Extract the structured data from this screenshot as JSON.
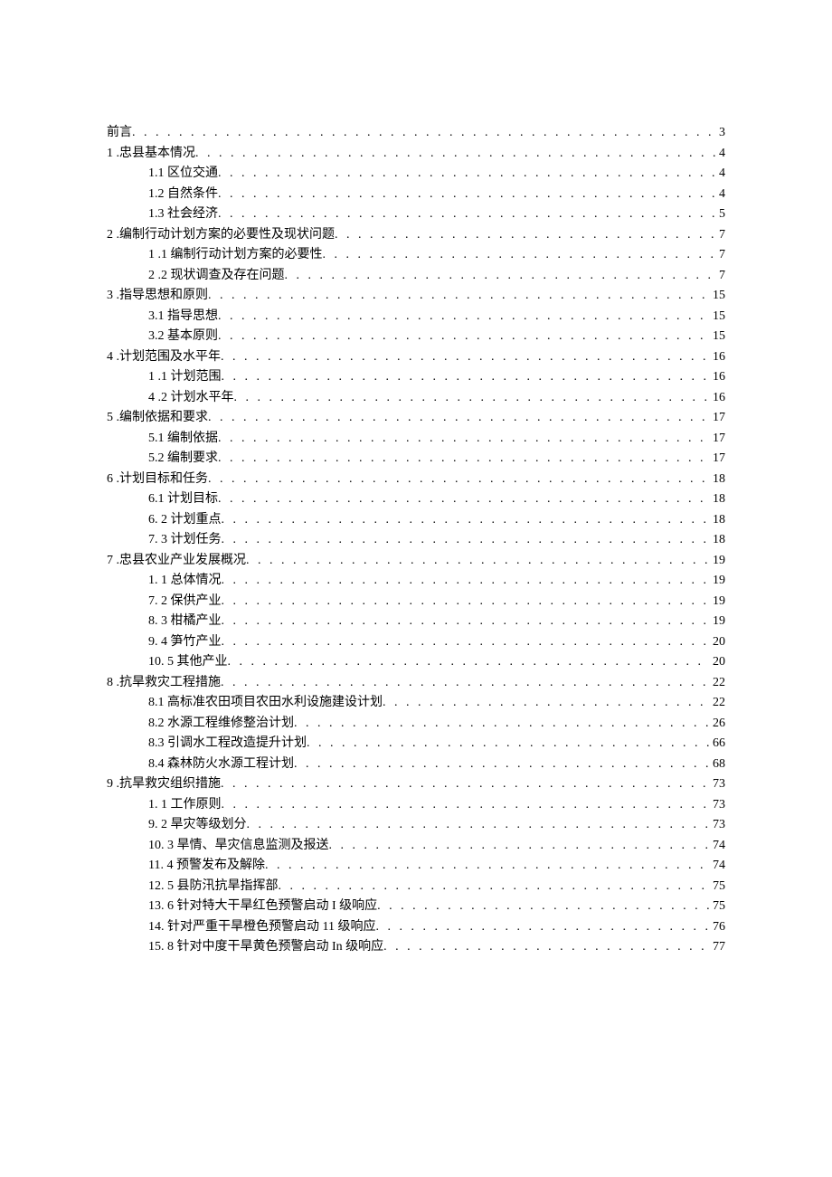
{
  "toc": [
    {
      "level": 0,
      "label": "前言",
      "page": "3"
    },
    {
      "level": 0,
      "label": "1 .忠县基本情况",
      "page": "4"
    },
    {
      "level": 1,
      "label": "1.1   区位交通",
      "page": "4"
    },
    {
      "level": 1,
      "label": "1.2   自然条件",
      "page": "4"
    },
    {
      "level": 1,
      "label": "1.3   社会经济",
      "page": "5"
    },
    {
      "level": 0,
      "label": "2   .编制行动计划方案的必要性及现状问题",
      "page": "7"
    },
    {
      "level": 1,
      "label": "1   .1 编制行动计划方案的必要性",
      "page": "7"
    },
    {
      "level": 1,
      "label": "2   .2 现状调查及存在问题",
      "page": "7"
    },
    {
      "level": 0,
      "label": "3   .指导思想和原则",
      "page": "15"
    },
    {
      "level": 1,
      "label": "3.1    指导思想",
      "page": "15"
    },
    {
      "level": 1,
      "label": "3.2    基本原则",
      "page": "15"
    },
    {
      "level": 0,
      "label": "4   .计划范围及水平年",
      "page": "16"
    },
    {
      "level": 1,
      "label": "1   .1 计划范围",
      "page": "16"
    },
    {
      "level": 1,
      "label": "4   .2 计划水平年",
      "page": "16"
    },
    {
      "level": 0,
      "label": "5   .编制依据和要求",
      "page": "17"
    },
    {
      "level": 1,
      "label": "5.1    编制依据",
      "page": "17"
    },
    {
      "level": 1,
      "label": "5.2    编制要求",
      "page": "17"
    },
    {
      "level": 0,
      "label": "6   .计划目标和任务",
      "page": "18"
    },
    {
      "level": 1,
      "label": "6.1    计划目标",
      "page": "18"
    },
    {
      "level": 1,
      "label": "6.   2 计划重点",
      "page": "18"
    },
    {
      "level": 1,
      "label": "7.   3 计划任务",
      "page": "18"
    },
    {
      "level": 0,
      "label": "7   .忠县农业产业发展概况",
      "page": "19"
    },
    {
      "level": 1,
      "label": "1.   1 总体情况",
      "page": "19"
    },
    {
      "level": 1,
      "label": "7.   2 保供产业",
      "page": "19"
    },
    {
      "level": 1,
      "label": "8.   3 柑橘产业",
      "page": "19"
    },
    {
      "level": 1,
      "label": "9.   4 笋竹产业",
      "page": "20"
    },
    {
      "level": 1,
      "label": "10. 5 其他产业",
      "page": "20"
    },
    {
      "level": 0,
      "label": "8   .抗旱救灾工程措施",
      "page": "22"
    },
    {
      "level": 1,
      "label": "8.1 高标准农田项目农田水利设施建设计划",
      "page": "22"
    },
    {
      "level": 1,
      "label": "8.2 水源工程维修整治计划",
      "page": "26"
    },
    {
      "level": 1,
      "label": "8.3 引调水工程改造提升计划",
      "page": "66"
    },
    {
      "level": 1,
      "label": "8.4 森林防火水源工程计划",
      "page": "68"
    },
    {
      "level": 0,
      "label": "9   .抗旱救灾组织措施",
      "page": "73"
    },
    {
      "level": 1,
      "label": "1.   1 工作原则",
      "page": "73"
    },
    {
      "level": 1,
      "label": "9.   2 旱灾等级划分",
      "page": "73"
    },
    {
      "level": 1,
      "label": "10. 3 旱情、旱灾信息监测及报送",
      "page": "74"
    },
    {
      "level": 1,
      "label": "11. 4 预警发布及解除",
      "page": "74"
    },
    {
      "level": 1,
      "label": "12. 5 县防汛抗旱指挥部",
      "page": "75"
    },
    {
      "level": 1,
      "label": "13. 6 针对特大干旱红色预警启动 I 级响应",
      "page": "75"
    },
    {
      "level": 1,
      "label": "14.    针对严重干旱橙色预警启动 11 级响应",
      "page": "76"
    },
    {
      "level": 1,
      "label": "15. 8 针对中度干旱黄色预警启动 In 级响应",
      "page": "77"
    }
  ]
}
